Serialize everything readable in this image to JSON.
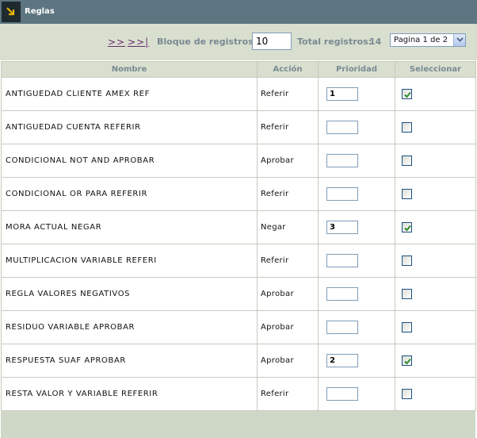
{
  "titlebar": {
    "title": "Reglas",
    "icon": "arrow-down-right-icon"
  },
  "toolbar": {
    "next_label": ">>",
    "last_label": ">>|",
    "block_label": "Bloque de registros:",
    "block_value": "10",
    "total_label": "Total registros:",
    "total_value": "14",
    "page_selected": "Pagina 1 de 2"
  },
  "table": {
    "headers": {
      "name": "Nombre",
      "action": "Acción",
      "priority": "Prioridad",
      "select": "Seleccionar"
    },
    "rows": [
      {
        "name": "ANTIGUEDAD CLIENTE AMEX REF",
        "action": "Referir",
        "priority": "1",
        "selected": true
      },
      {
        "name": "ANTIGUEDAD CUENTA REFERIR",
        "action": "Referir",
        "priority": "",
        "selected": false
      },
      {
        "name": "CONDICIONAL NOT AND APROBAR",
        "action": "Aprobar",
        "priority": "",
        "selected": false
      },
      {
        "name": "CONDICIONAL OR PARA REFERIR",
        "action": "Referir",
        "priority": "",
        "selected": false
      },
      {
        "name": "MORA ACTUAL NEGAR",
        "action": "Negar",
        "priority": "3",
        "selected": true
      },
      {
        "name": "MULTIPLICACION VARIABLE REFERI",
        "action": "Referir",
        "priority": "",
        "selected": false
      },
      {
        "name": "REGLA VALORES NEGATIVOS",
        "action": "Aprobar",
        "priority": "",
        "selected": false
      },
      {
        "name": "RESIDUO VARIABLE APROBAR",
        "action": "Aprobar",
        "priority": "",
        "selected": false
      },
      {
        "name": "RESPUESTA SUAF APROBAR",
        "action": "Aprobar",
        "priority": "2",
        "selected": true
      },
      {
        "name": "RESTA VALOR Y VARIABLE REFERIR",
        "action": "Referir",
        "priority": "",
        "selected": false
      }
    ]
  },
  "colors": {
    "titlebar": "#5d7580",
    "toolbar": "#d9dfcf",
    "link": "#6a2b6e",
    "header_text": "#7a8a93",
    "check": "#2e8b2e"
  }
}
